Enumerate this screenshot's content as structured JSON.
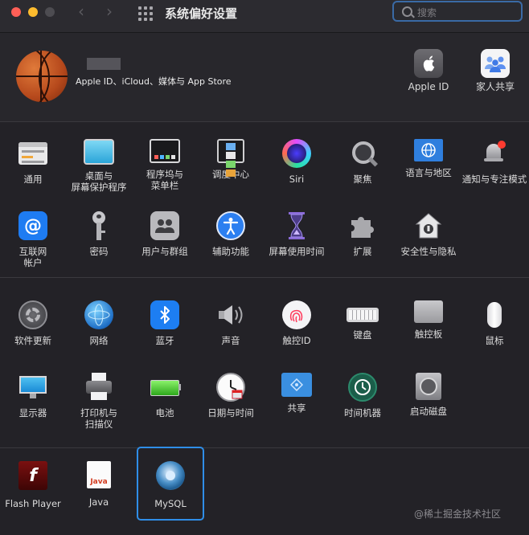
{
  "window": {
    "title": "系统偏好设置",
    "nav_back": "‹",
    "nav_forward": "›",
    "search_placeholder": "搜索"
  },
  "account": {
    "label": "Apple ID、iCloud、媒体与 App Store",
    "items": [
      {
        "label": "Apple ID",
        "icon": "apple-icon"
      },
      {
        "label": "家人共享",
        "icon": "family-sharing-icon"
      }
    ]
  },
  "section1": {
    "row1": [
      {
        "label": "通用",
        "icon": "general-icon"
      },
      {
        "label": "桌面与\n屏幕保护程序",
        "icon": "desktop-icon"
      },
      {
        "label": "程序坞与\n菜单栏",
        "icon": "dock-icon"
      },
      {
        "label": "调度中心",
        "icon": "mission-control-icon"
      },
      {
        "label": "Siri",
        "icon": "siri-icon"
      },
      {
        "label": "聚焦",
        "icon": "spotlight-icon"
      },
      {
        "label": "语言与地区",
        "icon": "language-icon"
      },
      {
        "label": "通知与专注模式",
        "icon": "notifications-icon"
      }
    ],
    "row2": [
      {
        "label": "互联网\n帐户",
        "icon": "internet-accounts-icon"
      },
      {
        "label": "密码",
        "icon": "key-icon"
      },
      {
        "label": "用户与群组",
        "icon": "users-icon"
      },
      {
        "label": "辅助功能",
        "icon": "accessibility-icon"
      },
      {
        "label": "屏幕使用时间",
        "icon": "hourglass-icon"
      },
      {
        "label": "扩展",
        "icon": "puzzle-icon"
      },
      {
        "label": "安全性与隐私",
        "icon": "security-icon"
      }
    ]
  },
  "section2": {
    "row1": [
      {
        "label": "软件更新",
        "icon": "gear-icon"
      },
      {
        "label": "网络",
        "icon": "network-icon"
      },
      {
        "label": "蓝牙",
        "icon": "bluetooth-icon"
      },
      {
        "label": "声音",
        "icon": "speaker-icon"
      },
      {
        "label": "触控ID",
        "icon": "fingerprint-icon"
      },
      {
        "label": "键盘",
        "icon": "keyboard-icon"
      },
      {
        "label": "触控板",
        "icon": "trackpad-icon"
      },
      {
        "label": "鼠标",
        "icon": "mouse-icon"
      }
    ],
    "row2": [
      {
        "label": "显示器",
        "icon": "display-icon"
      },
      {
        "label": "打印机与\n扫描仪",
        "icon": "printer-icon"
      },
      {
        "label": "电池",
        "icon": "battery-icon"
      },
      {
        "label": "日期与时间",
        "icon": "clock-icon"
      },
      {
        "label": "共享",
        "icon": "sharing-folder-icon"
      },
      {
        "label": "时间机器",
        "icon": "time-machine-icon"
      },
      {
        "label": "启动磁盘",
        "icon": "disk-icon"
      }
    ]
  },
  "section3": {
    "items": [
      {
        "label": "Flash Player",
        "icon": "flash-icon",
        "glyph": "f"
      },
      {
        "label": "Java",
        "icon": "java-icon",
        "glyph": "Java"
      },
      {
        "label": "MySQL",
        "icon": "mysql-icon",
        "selected": true
      }
    ]
  },
  "watermark": "@稀土掘金技术社区",
  "colors": {
    "accent": "#2f8ee8",
    "background": "#232227"
  }
}
